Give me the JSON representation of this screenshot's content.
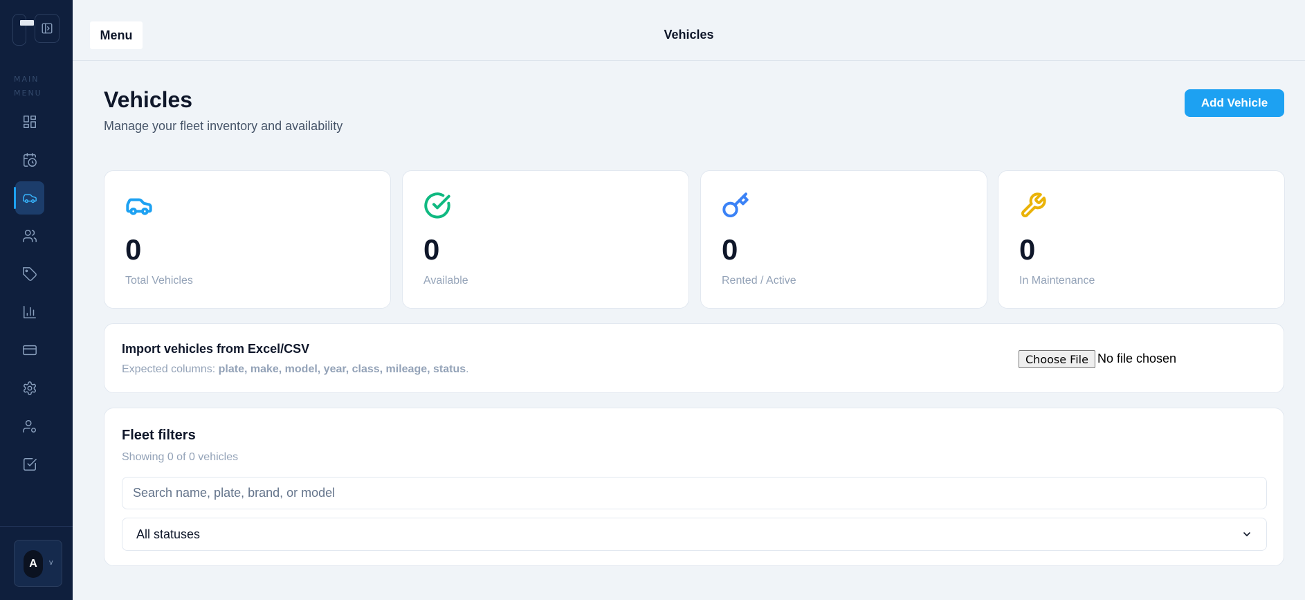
{
  "sidebar": {
    "section_label": "MAIN MENU",
    "items": [
      {
        "icon": "dashboard-icon"
      },
      {
        "icon": "calendar-clock-icon"
      },
      {
        "icon": "car-icon",
        "active": true
      },
      {
        "icon": "users-icon"
      },
      {
        "icon": "tag-icon"
      },
      {
        "icon": "bar-chart-icon"
      },
      {
        "icon": "credit-card-icon"
      },
      {
        "icon": "gear-icon"
      },
      {
        "icon": "user-settings-icon"
      },
      {
        "icon": "checkbox-icon"
      }
    ],
    "user": {
      "initial": "A",
      "chevron": "v"
    }
  },
  "topbar": {
    "menu_label": "Menu",
    "title": "Vehicles"
  },
  "header": {
    "title": "Vehicles",
    "subtitle": "Manage your fleet inventory and availability",
    "add_button": "Add Vehicle"
  },
  "stats": [
    {
      "icon": "car-icon",
      "value": "0",
      "label": "Total Vehicles",
      "color": "#1da1f2"
    },
    {
      "icon": "check-circle-icon",
      "value": "0",
      "label": "Available",
      "color": "#10b981"
    },
    {
      "icon": "key-icon",
      "value": "0",
      "label": "Rented / Active",
      "color": "#3b82f6"
    },
    {
      "icon": "wrench-icon",
      "value": "0",
      "label": "In Maintenance",
      "color": "#eab308"
    }
  ],
  "import": {
    "title": "Import vehicles from Excel/CSV",
    "desc_prefix": "Expected columns: ",
    "columns": "plate, make, model, year, class, mileage, status",
    "desc_suffix": ".",
    "file_button": "Choose File",
    "file_status": "No file chosen"
  },
  "filters": {
    "title": "Fleet filters",
    "count_text": "Showing 0 of 0 vehicles",
    "search_placeholder": "Search name, plate, brand, or model",
    "status_selected": "All statuses"
  },
  "colors": {
    "sidebar_bg": "#0f1f3d",
    "accent": "#1da1f2",
    "page_bg": "#f0f4f8"
  }
}
